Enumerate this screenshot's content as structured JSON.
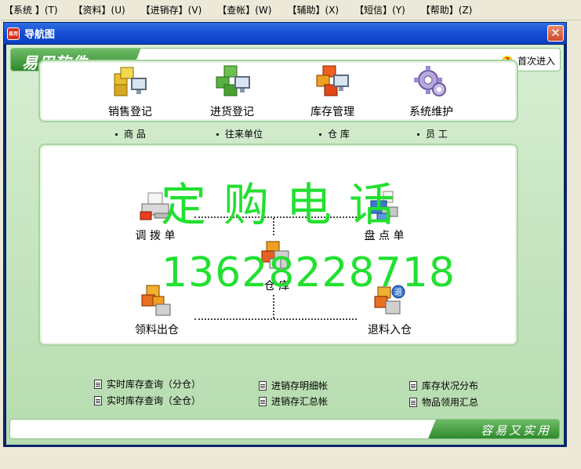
{
  "menu": [
    "【系统 】(T)",
    "【资料】(U)",
    "【进销存】(V)",
    "【查帐】(W)",
    "【辅助】(X)",
    "【短信】(Y)",
    "【帮助】(Z)"
  ],
  "window": {
    "title": "导航图",
    "icon_text": "易用",
    "close": "✕"
  },
  "header": {
    "brand": "易用软件",
    "help_label": "首次进入",
    "help_icon": "?"
  },
  "top_items": [
    {
      "label": "销售登记",
      "icon": "sales-blocks-icon"
    },
    {
      "label": "进货登记",
      "icon": "purchase-blocks-icon"
    },
    {
      "label": "库存管理",
      "icon": "inventory-blocks-icon"
    },
    {
      "label": "系统维护",
      "icon": "gear-icon"
    }
  ],
  "sub_links": [
    "商  品",
    "往来单位",
    "仓  库",
    "员  工"
  ],
  "nodes": {
    "transfer": "调 拨 单",
    "stocktake": "盘 点 单",
    "warehouse": "仓  库",
    "issue": "领料出仓",
    "return": "退料入仓"
  },
  "overlay": {
    "line1": "定购电话",
    "line2": "13628228718"
  },
  "reports": [
    "实时库存查询（分仓）",
    "实时库存查询（全仓）",
    "进销存明细帐",
    "进销存汇总帐",
    "库存状况分布",
    "物品领用汇总"
  ],
  "footer": {
    "slogan": "容易又实用"
  },
  "colors": {
    "accent": "#2e8a2c",
    "overlay": "#22e030",
    "titlebar": "#1650d6"
  }
}
